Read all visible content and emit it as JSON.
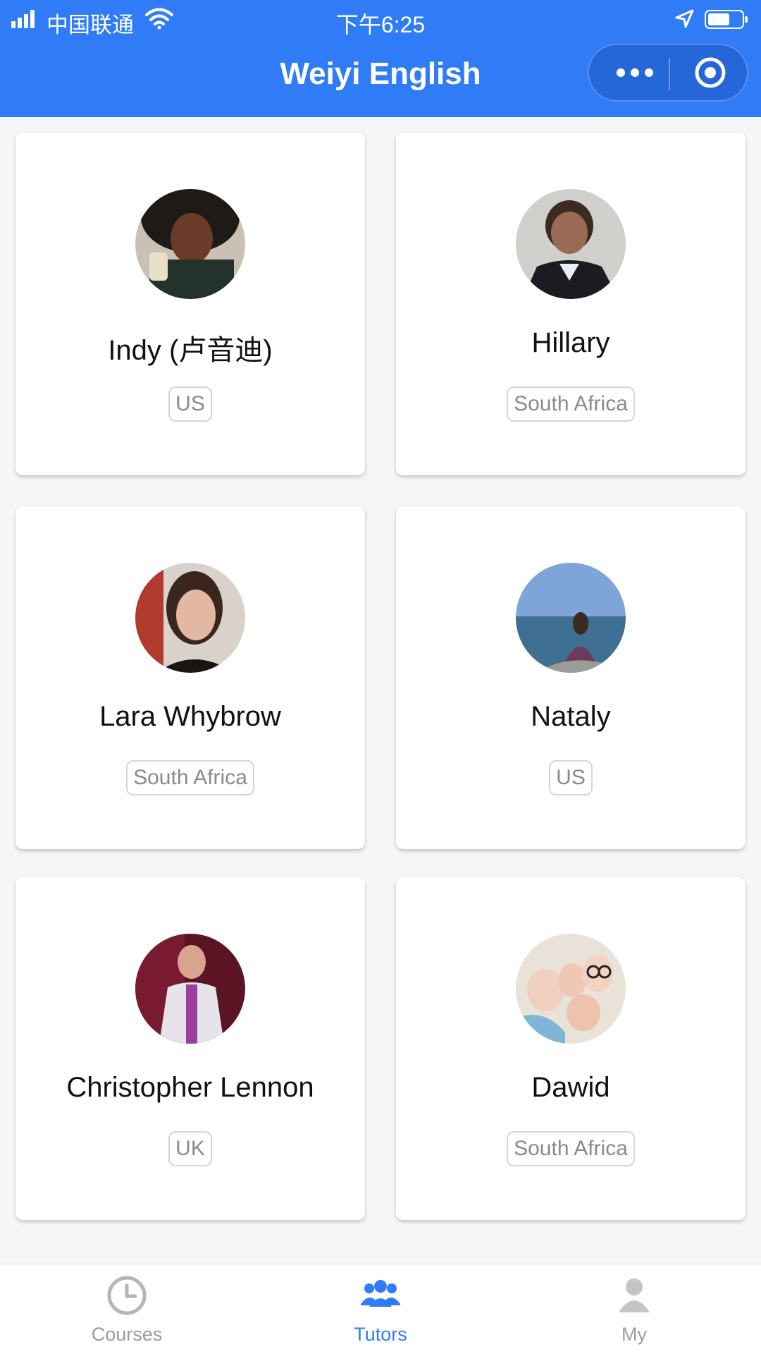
{
  "status_bar": {
    "carrier": "中国联通",
    "time": "下午6:25",
    "icons": [
      "signal-icon",
      "wifi-icon",
      "location-icon",
      "battery-icon"
    ]
  },
  "header": {
    "title": "Weiyi English",
    "capsule_icons": [
      "more-dots-icon",
      "target-icon"
    ]
  },
  "tutors": [
    {
      "name": "Indy (卢音迪)",
      "country": "US"
    },
    {
      "name": "Hillary",
      "country": "South Africa"
    },
    {
      "name": "Lara Whybrow",
      "country": "South Africa"
    },
    {
      "name": "Nataly",
      "country": "US"
    },
    {
      "name": "Christopher Lennon",
      "country": "UK"
    },
    {
      "name": "Dawid",
      "country": "South Africa"
    }
  ],
  "tabbar": {
    "items": [
      {
        "label": "Courses",
        "icon": "clock-icon"
      },
      {
        "label": "Tutors",
        "icon": "group-icon"
      },
      {
        "label": "My",
        "icon": "person-icon"
      }
    ],
    "active": "Tutors"
  },
  "colors": {
    "accent": "#2f7cf6",
    "background": "#f5f6f8",
    "inactive": "#9b9b9b"
  }
}
